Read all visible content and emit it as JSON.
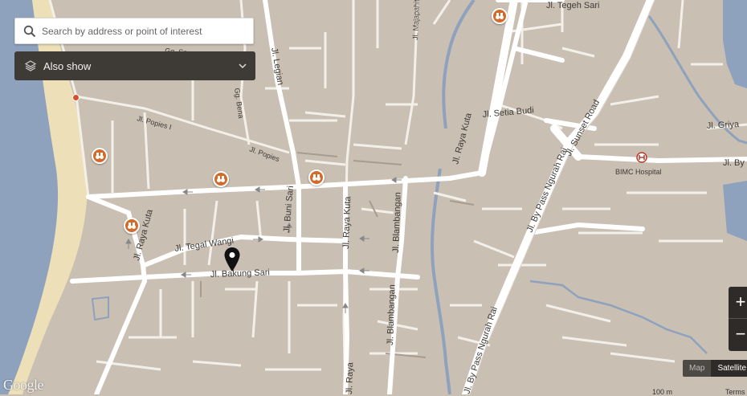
{
  "search": {
    "placeholder": "Search by address or point of interest"
  },
  "also_show": {
    "label": "Also show"
  },
  "zoom": {
    "in": "+",
    "out": "−"
  },
  "map_type": {
    "map": "Map",
    "satellite": "Satellite"
  },
  "attribution": {
    "logo": "Google",
    "scale": "100 m",
    "terms": "Terms"
  },
  "streets": {
    "tegeh_sari": "Jl. Tegeh Sari",
    "gg_sorga": "Gg. Sorga",
    "legian": "Jl. Legian",
    "majapahit": "Jl. Majapahit",
    "setia_budi": "Jl. Setia Budi",
    "raya_kuta_north": "Jl. Raya Kuta",
    "sunset_road": "Jl. Sunset Road",
    "griya": "Jl. Griya",
    "popies_1": "Jl. Popies I",
    "popies_2": "Jl. Popies",
    "bypass_ngurah_rai": "Jl. By Pass Ngurah Rai",
    "bypass_east": "Jl. By",
    "bimc": "BIMC Hospital",
    "raya_kuta_west": "Jl. Raya Kuta",
    "tegal_wangi": "Jl. Tegal Wangi",
    "buni_sari": "Jl. Buni Sari",
    "raya_kuta_mid": "Jl. Raya Kuta",
    "blambangan_1": "Jl. Blambangan",
    "blambangan_2": "Jl. Blambangan",
    "bakung_sari": "Jl. Bakung Sari",
    "bypass_south": "Jl. By Pass Ngurah Rai",
    "raya_south": "Jl. Raya",
    "gg_bena": "Gg. Bena"
  },
  "colors": {
    "land": "#c9bfb3",
    "road": "#ffffff",
    "sea": "#8ea2bd",
    "beach": "#ede0b8",
    "poi": "#d46a2a",
    "panel": "#3e3a36"
  }
}
